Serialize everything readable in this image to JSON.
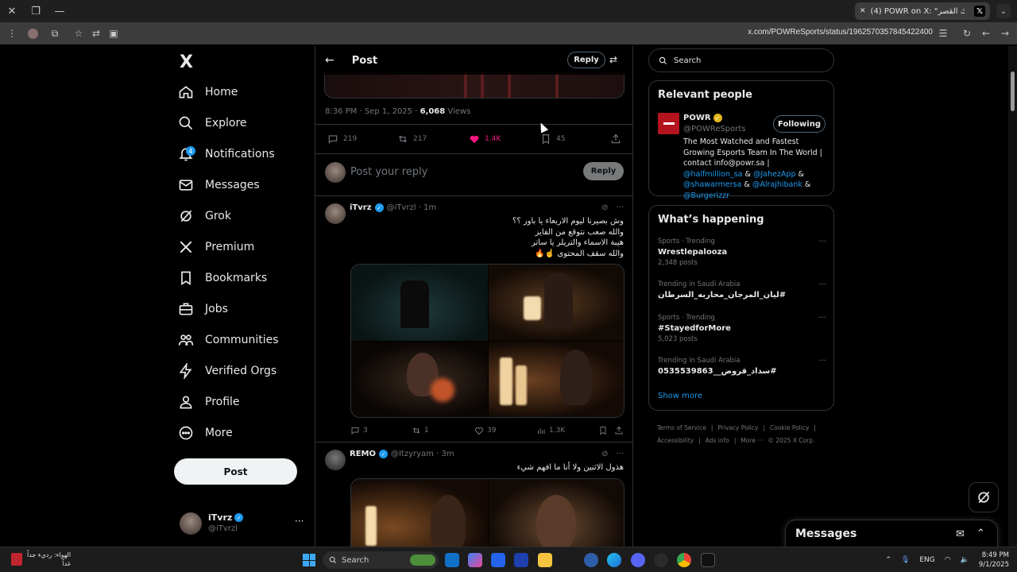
{
  "browser": {
    "tab_title": "(4) POWR on X: \"ملك القصر",
    "url": "x.com/POWReSports/status/1962570357845422400"
  },
  "nav": {
    "brand": "X",
    "items": [
      {
        "label": "Home",
        "icon": "home-icon"
      },
      {
        "label": "Explore",
        "icon": "search-icon"
      },
      {
        "label": "Notifications",
        "icon": "bell-icon",
        "badge": "4"
      },
      {
        "label": "Messages",
        "icon": "envelope-icon"
      },
      {
        "label": "Grok",
        "icon": "grok-icon"
      },
      {
        "label": "Premium",
        "icon": "x-logo-icon"
      },
      {
        "label": "Bookmarks",
        "icon": "bookmark-icon"
      },
      {
        "label": "Jobs",
        "icon": "briefcase-icon"
      },
      {
        "label": "Communities",
        "icon": "people-icon"
      },
      {
        "label": "Verified Orgs",
        "icon": "lightning-icon"
      },
      {
        "label": "Profile",
        "icon": "person-icon"
      },
      {
        "label": "More",
        "icon": "more-circle-icon"
      }
    ],
    "post_button": "Post",
    "account": {
      "name": "iTvrz",
      "handle": "@iTvrzl"
    }
  },
  "post": {
    "header_title": "Post",
    "reply_button": "Reply",
    "time": "8:36 PM · Sep 1, 2025 · ",
    "views_count": "6,068",
    "views_label": " Views",
    "stats": {
      "replies": "219",
      "reposts": "217",
      "likes": "1.4K",
      "bookmarks": "45"
    },
    "reply_placeholder": "Post your reply",
    "reply_submit": "Reply"
  },
  "replies": [
    {
      "name": "iTvrz",
      "handle": "@iTvrzl · 1m",
      "lines": [
        "وش بصيرنا ليوم الاربعاء يا باور ؟؟",
        "والله صعب نتوقع من الفايز",
        "هيبة الاسماء والتريلر يا ساتر",
        "والله سقف المحتوى ☝️🔥"
      ],
      "stats": {
        "replies": "3",
        "reposts": "1",
        "likes": "39",
        "views": "1.3K"
      }
    },
    {
      "name": "REMO",
      "handle": "@Itzyryam · 3m",
      "lines": [
        "هذول الاثنين ولا أنا ما افهم شيء"
      ]
    }
  ],
  "sidebar": {
    "search_placeholder": "Search",
    "relevant": {
      "title": "Relevant people",
      "name": "POWR",
      "handle": "@POWReSports",
      "follow_label": "Following",
      "bio_text": "The Most Watched and Fastest Growing Esports Team In The World | contact info@powr.sa | ",
      "bio_links": [
        "@halfmillion_sa",
        "@JahezApp",
        "@shawarmersa",
        "@Alrajhibank",
        "@Burgerizzr"
      ]
    },
    "happening": {
      "title": "What’s happening",
      "trends": [
        {
          "context": "Sports · Trending",
          "title": "Wrestlepalooza",
          "count": "2,348 posts",
          "rtl": false
        },
        {
          "context": "Trending in Saudi Arabia",
          "title": "#ليان_المرجان_محاربه_السرطان",
          "count": "",
          "rtl": true
        },
        {
          "context": "Sports · Trending",
          "title": "#StayedforMore",
          "count": "5,023 posts",
          "rtl": false
        },
        {
          "context": "Trending in Saudi Arabia",
          "title": "#سداد_قروض__0535539863",
          "count": "",
          "rtl": true
        }
      ],
      "show_more": "Show more"
    },
    "footer": [
      "Terms of Service",
      "|",
      "Privacy Policy",
      "|",
      "Cookie Policy",
      "|",
      "Accessibility",
      "|",
      "Ads info",
      "|",
      "More ···",
      "© 2025 X Corp."
    ]
  },
  "messages_drawer": {
    "title": "Messages"
  },
  "taskbar": {
    "weather_line1": "الهواء: رديء جداً",
    "weather_line2": "غداً",
    "search": "Search",
    "lang": "ENG",
    "time": "8:49 PM",
    "date": "9/1/2025"
  },
  "colors": {
    "accent": "#1d9bf0",
    "like": "#f91880",
    "background": "#000000",
    "border": "#2f3336",
    "muted": "#71767b"
  }
}
